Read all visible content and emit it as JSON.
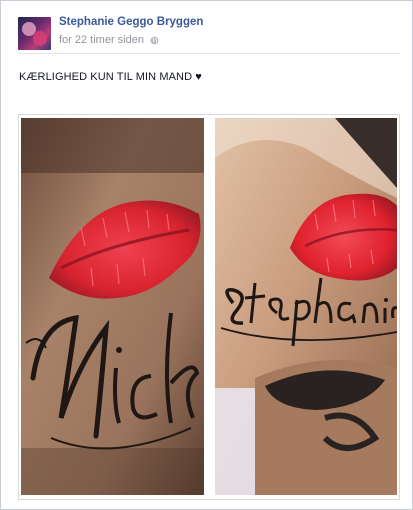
{
  "post": {
    "author": "Stephanie Geggo Bryggen",
    "timestamp": "for 22 timer siden",
    "message": "KÆRLIGHED KUN TIL MIN MAND ♥",
    "audience_icon": "globe-icon",
    "photos": [
      {
        "tattoo_text": "Nick",
        "skin_color": "#a07860",
        "lips_color": "#d8242f"
      },
      {
        "tattoo_text": "Stephanie",
        "skin_color": "#c99c7e",
        "lips_color": "#e0222e"
      }
    ]
  },
  "colors": {
    "link": "#3b5998",
    "meta": "#90949c",
    "text": "#141823"
  }
}
